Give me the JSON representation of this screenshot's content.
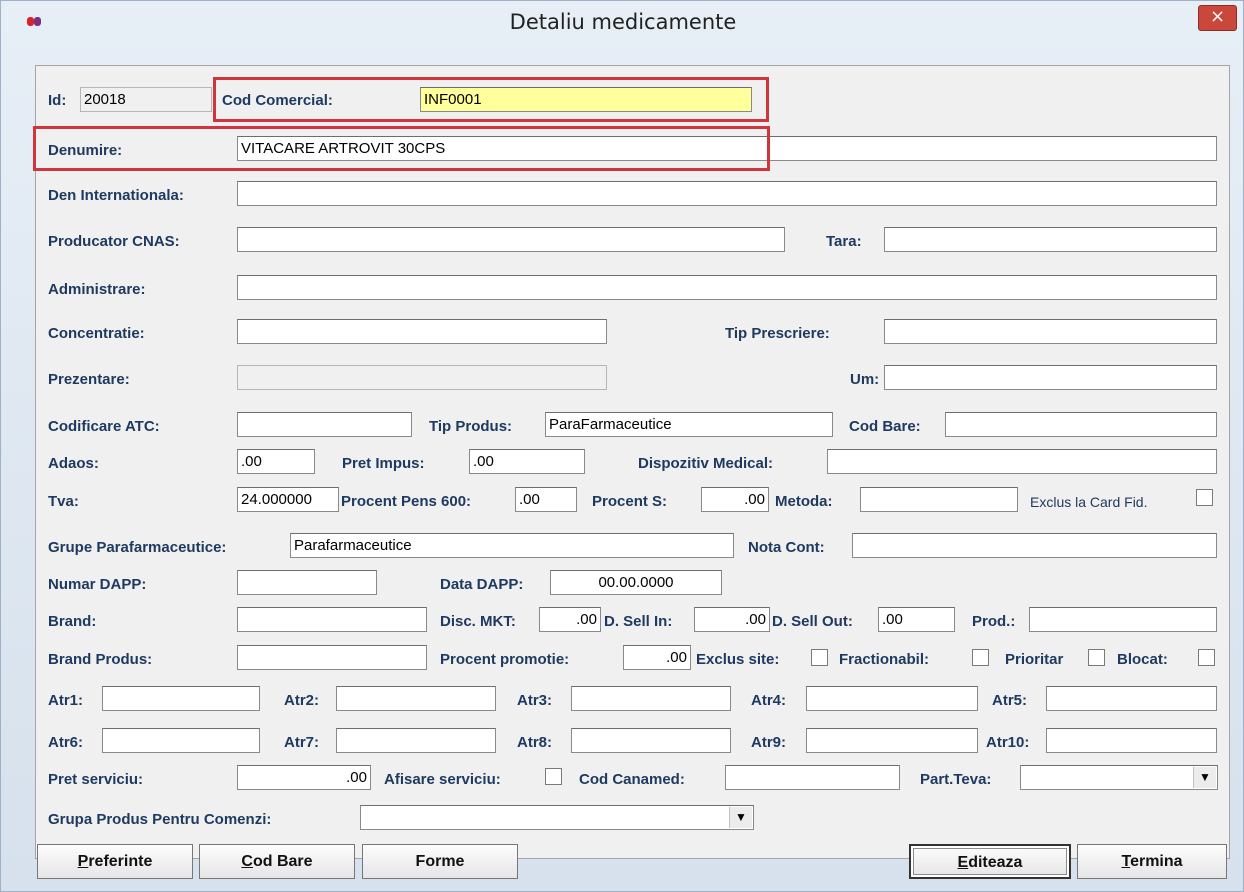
{
  "window": {
    "title": "Detaliu medicamente",
    "close_glyph": "×",
    "app_icon": "pill-icon"
  },
  "highlight_color": "#d0343c",
  "id": {
    "label": "Id:",
    "value": "20018"
  },
  "cod_comercial": {
    "label": "Cod Comercial:",
    "value": "INF0001"
  },
  "denumire": {
    "label": "Denumire:",
    "value": "VITACARE ARTROVIT 30CPS"
  },
  "den_internationala": {
    "label": "Den Internationala:",
    "value": ""
  },
  "producator_cnas": {
    "label": "Producator CNAS:",
    "value": ""
  },
  "tara": {
    "label": "Tara:",
    "value": ""
  },
  "administrare": {
    "label": "Administrare:",
    "value": ""
  },
  "concentratie": {
    "label": "Concentratie:",
    "value": ""
  },
  "tip_prescriere": {
    "label": "Tip Prescriere:",
    "value": ""
  },
  "prezentare": {
    "label": "Prezentare:",
    "value": ""
  },
  "um": {
    "label": "Um:",
    "value": ""
  },
  "codificare_atc": {
    "label": "Codificare ATC:",
    "value": ""
  },
  "tip_produs": {
    "label": "Tip Produs:",
    "value": "ParaFarmaceutice"
  },
  "cod_bare": {
    "label": "Cod Bare:",
    "value": ""
  },
  "adaos": {
    "label": "Adaos:",
    "value": ".00"
  },
  "pret_impus": {
    "label": "Pret Impus:",
    "value": ".00"
  },
  "dispozitiv_medical": {
    "label": "Dispozitiv Medical:",
    "value": ""
  },
  "tva": {
    "label": "Tva:",
    "value": "24.000000"
  },
  "procent_pens_600": {
    "label": "Procent Pens 600:",
    "value": ".00"
  },
  "procent_s": {
    "label": "Procent S:",
    "value": ".00"
  },
  "metoda": {
    "label": "Metoda:",
    "value": ""
  },
  "exclus_card_fid": {
    "label": "Exclus la Card Fid.",
    "checked": false
  },
  "grupe_parafarmaceutice": {
    "label": "Grupe Parafarmaceutice:",
    "value": "Parafarmaceutice"
  },
  "nota_cont": {
    "label": "Nota Cont:",
    "value": ""
  },
  "numar_dapp": {
    "label": "Numar DAPP:",
    "value": ""
  },
  "data_dapp": {
    "label": "Data DAPP:",
    "value": "00.00.0000"
  },
  "brand": {
    "label": "Brand:",
    "value": ""
  },
  "disc_mkt": {
    "label": "Disc. MKT:",
    "value": ".00"
  },
  "d_sell_in": {
    "label": "D. Sell In:",
    "value": ".00"
  },
  "d_sell_out": {
    "label": "D. Sell Out:",
    "value": ".00"
  },
  "prod": {
    "label": "Prod.:",
    "value": ""
  },
  "brand_produs": {
    "label": "Brand Produs:",
    "value": ""
  },
  "procent_promotie": {
    "label": "Procent promotie:",
    "value": ".00"
  },
  "exclus_site": {
    "label": "Exclus site:",
    "checked": false
  },
  "fractionabil": {
    "label": "Fractionabil:",
    "checked": false
  },
  "prioritar": {
    "label": "Prioritar",
    "checked": false
  },
  "blocat": {
    "label": "Blocat:",
    "checked": false
  },
  "atr": [
    {
      "label": "Atr1:",
      "value": ""
    },
    {
      "label": "Atr2:",
      "value": ""
    },
    {
      "label": "Atr3:",
      "value": ""
    },
    {
      "label": "Atr4:",
      "value": ""
    },
    {
      "label": "Atr5:",
      "value": ""
    },
    {
      "label": "Atr6:",
      "value": ""
    },
    {
      "label": "Atr7:",
      "value": ""
    },
    {
      "label": "Atr8:",
      "value": ""
    },
    {
      "label": "Atr9:",
      "value": ""
    },
    {
      "label": "Atr10:",
      "value": ""
    }
  ],
  "pret_serviciu": {
    "label": "Pret serviciu:",
    "value": ".00"
  },
  "afisare_serviciu": {
    "label": "Afisare serviciu:",
    "checked": false
  },
  "cod_canamed": {
    "label": "Cod Canamed:",
    "value": ""
  },
  "part_teva": {
    "label": "Part.Teva:",
    "value": ""
  },
  "grupa_produs_comenzi": {
    "label": "Grupa Produs Pentru Comenzi:",
    "value": ""
  },
  "dropdown_glyph": "▼",
  "buttons": {
    "preferinte": {
      "hotkey": "P",
      "rest": "referinte"
    },
    "cod_bare": {
      "hotkey": "C",
      "rest": "od Bare"
    },
    "forme": {
      "label": "Forme"
    },
    "editeaza": {
      "hotkey": "E",
      "rest": "diteaza"
    },
    "termina": {
      "hotkey": "T",
      "rest": "ermina"
    }
  }
}
